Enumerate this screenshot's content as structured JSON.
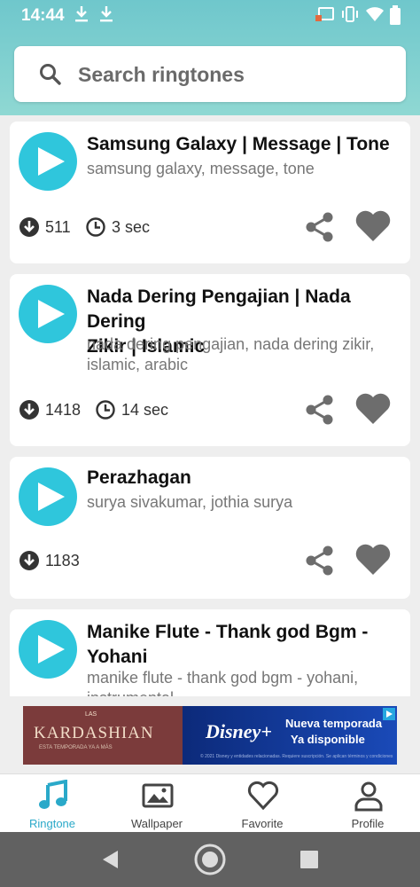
{
  "status_bar": {
    "time": "14:44",
    "icons": [
      "download-icon",
      "download-icon",
      "cast-icon",
      "vibrate-icon",
      "wifi-icon",
      "battery-icon"
    ]
  },
  "search": {
    "placeholder": "Search ringtones",
    "value": ""
  },
  "colors": {
    "accent": "#2fc6dc",
    "header": "#7ccfcf",
    "icon_gray": "#6d6d6d"
  },
  "ringtones": [
    {
      "title_line1": "Samsung Galaxy | Message | Tone",
      "title_line2": "",
      "tags_line1": "samsung galaxy, message, tone",
      "tags_line2": "",
      "downloads": "511",
      "duration": "3 sec"
    },
    {
      "title_line1": "Nada Dering Pengajian | Nada Dering",
      "title_line2": "Zikir | Islamic",
      "tags_line1": "nada dering pengajian, nada dering zikir,",
      "tags_line2": "islamic, arabic",
      "downloads": "1418",
      "duration": "14 sec"
    },
    {
      "title_line1": "Perazhagan",
      "title_line2": "",
      "tags_line1": "surya sivakumar, jothia surya",
      "tags_line2": "",
      "downloads": "1183",
      "duration": ""
    },
    {
      "title_line1": "Manike Flute - Thank god Bgm -",
      "title_line2": "Yohani",
      "tags_line1": "manike flute - thank god bgm - yohani,",
      "tags_line2": "instrumental",
      "downloads": "",
      "duration": ""
    }
  ],
  "ad": {
    "pretitle": "LAS",
    "brand": "KARDASHIAN",
    "brand_sub": "ESTA TEMPORADA YA A MÁS",
    "network": "Disney+",
    "promo_line1": "Nueva temporada",
    "promo_line2": "Ya disponible",
    "fine_print": "© 2021 Disney y entidades relacionadas. Requiere suscripción. Se aplican términos y condiciones"
  },
  "bottom_nav": [
    {
      "label": "Ringtone",
      "icon": "music-note-icon",
      "active": true
    },
    {
      "label": "Wallpaper",
      "icon": "image-icon",
      "active": false
    },
    {
      "label": "Favorite",
      "icon": "heart-outline-icon",
      "active": false
    },
    {
      "label": "Profile",
      "icon": "person-icon",
      "active": false
    }
  ],
  "system_nav": [
    "back-icon",
    "home-icon",
    "recents-icon"
  ]
}
